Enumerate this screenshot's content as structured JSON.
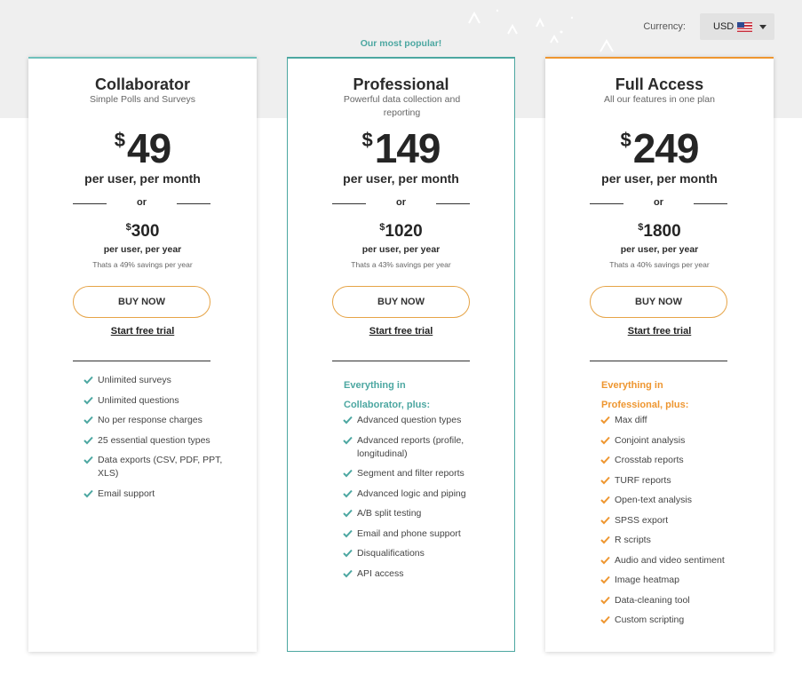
{
  "currency": {
    "label": "Currency:",
    "selected": "USD"
  },
  "popular_label": "Our most popular!",
  "colors": {
    "teal": "#4ca7a1",
    "orange": "#ee9630",
    "teal_light": "#6fc0bb"
  },
  "plans": [
    {
      "name": "Collaborator",
      "tagline": "Simple Polls and Surveys",
      "currency_symbol": "$",
      "monthly_price": "49",
      "monthly_unit": "per user, per month",
      "or": "or",
      "yearly_price": "300",
      "yearly_unit": "per user, per year",
      "savings": "Thats a 49% savings per year",
      "buy_label": "BUY NOW",
      "trial_label": "Start free trial",
      "features": [
        "Unlimited surveys",
        "Unlimited questions",
        "No per response charges",
        "25 essential question types",
        "Data exports (CSV, PDF, PPT, XLS)",
        "Email support"
      ]
    },
    {
      "name": "Professional",
      "tagline": "Powerful data collection and reporting",
      "currency_symbol": "$",
      "monthly_price": "149",
      "monthly_unit": "per user, per month",
      "or": "or",
      "yearly_price": "1020",
      "yearly_unit": "per user, per year",
      "savings": "Thats a 43% savings per year",
      "buy_label": "BUY NOW",
      "trial_label": "Start free trial",
      "intro": "Everything in Collaborator, plus:",
      "features": [
        "Advanced question types",
        "Advanced reports (profile, longitudinal)",
        "Segment and filter reports",
        "Advanced logic and piping",
        "A/B split testing",
        "Email and phone support",
        "Disqualifications",
        "API access"
      ]
    },
    {
      "name": "Full Access",
      "tagline": "All our features in one plan",
      "currency_symbol": "$",
      "monthly_price": "249",
      "monthly_unit": "per user, per month",
      "or": "or",
      "yearly_price": "1800",
      "yearly_unit": "per user, per year",
      "savings": "Thats a 40% savings per year",
      "buy_label": "BUY NOW",
      "trial_label": "Start free trial",
      "intro": "Everything in Professional, plus:",
      "features": [
        "Max diff",
        "Conjoint analysis",
        "Crosstab reports",
        "TURF reports",
        "Open-text analysis",
        "SPSS export",
        "R scripts",
        "Audio and video sentiment",
        "Image heatmap",
        "Data-cleaning tool",
        "Custom scripting"
      ]
    }
  ]
}
